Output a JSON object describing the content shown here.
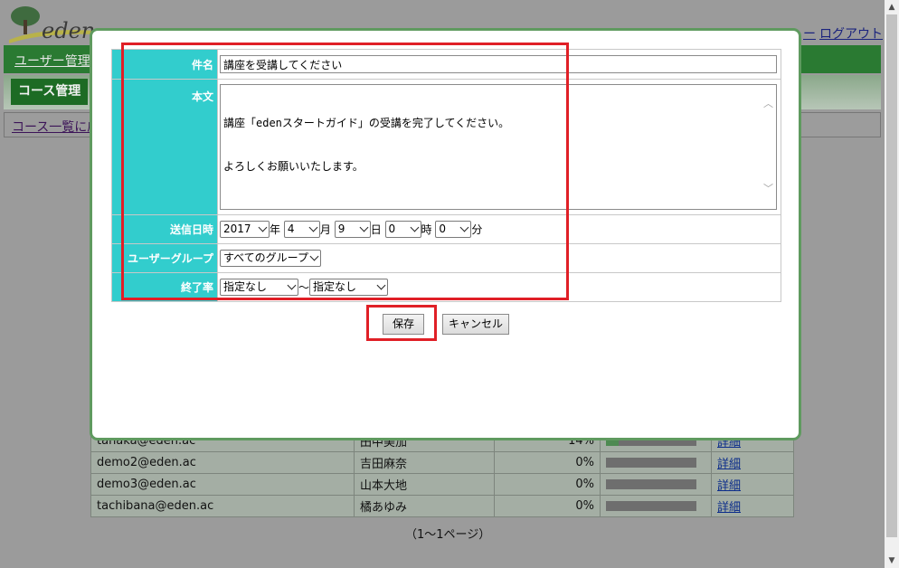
{
  "background": {
    "logo_text": "eden",
    "top_links": [
      "ー",
      "ログアウト"
    ],
    "nav_item": "ユーザー管理",
    "course_tab": "コース管理",
    "breadcrumb": "コース一覧に戻",
    "users": [
      {
        "email": "tanaka@eden.ac",
        "name": "田中美加",
        "rate": "14%",
        "fill": 0.14,
        "detail": "詳細"
      },
      {
        "email": "demo2@eden.ac",
        "name": "吉田麻奈",
        "rate": "0%",
        "fill": 0,
        "detail": "詳細"
      },
      {
        "email": "demo3@eden.ac",
        "name": "山本大地",
        "rate": "0%",
        "fill": 0,
        "detail": "詳細"
      },
      {
        "email": "tachibana@eden.ac",
        "name": "橘あゆみ",
        "rate": "0%",
        "fill": 0,
        "detail": "詳細"
      }
    ],
    "pagination": "（1〜1ページ）"
  },
  "form": {
    "subject_label": "件名",
    "subject_value": "講座を受講してください",
    "body_label": "本文",
    "body_lines": [
      "講座「edenスタートガイド」の受講を完了してください。",
      "よろしくお願いいたします。"
    ],
    "datetime_label": "送信日時",
    "year": "2017",
    "year_unit": "年",
    "month": "4",
    "month_unit": "月",
    "day": "9",
    "day_unit": "日",
    "hour": "0",
    "hour_unit": "時",
    "minute": "0",
    "minute_unit": "分",
    "group_label": "ユーザーグループ",
    "group_value": "すべてのグループ",
    "rate_label": "終了率",
    "rate_from": "指定なし",
    "rate_sep": "〜",
    "rate_to": "指定なし"
  },
  "buttons": {
    "save": "保存",
    "cancel": "キャンセル"
  },
  "colors": {
    "header_cell": "#32cdcd",
    "annotation": "#e01f26",
    "modal_border": "#5f9a5f"
  }
}
